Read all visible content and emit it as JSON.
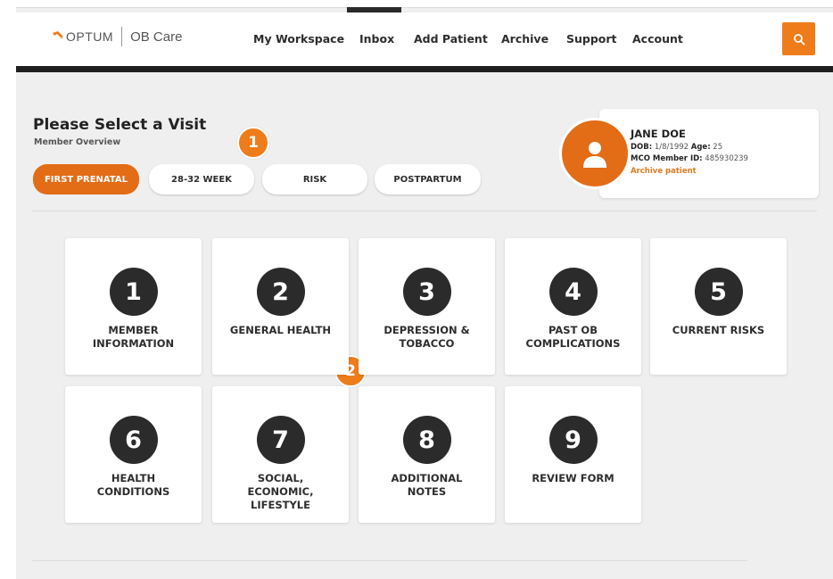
{
  "brand": {
    "name": "OPTUM",
    "product": "OB Care",
    "mark_color": "#ef7c1a"
  },
  "nav": {
    "items": [
      {
        "label": "My Workspace"
      },
      {
        "label": "Inbox"
      },
      {
        "label": "Add Patient"
      },
      {
        "label": "Archive"
      },
      {
        "label": "Support"
      },
      {
        "label": "Account"
      }
    ],
    "search_icon": "search-icon"
  },
  "page": {
    "title": "Please Select a Visit",
    "subtitle": "Member Overview"
  },
  "callouts": [
    "1",
    "2"
  ],
  "visit_tabs": [
    {
      "label": "FIRST PRENATAL",
      "active": true
    },
    {
      "label": "28-32 WEEK",
      "active": false
    },
    {
      "label": "RISK",
      "active": false
    },
    {
      "label": "POSTPARTUM",
      "active": false
    }
  ],
  "patient": {
    "avatar_icon": "user-icon",
    "name": "JANE DOE",
    "dob_label": "DOB:",
    "dob": "1/8/1992",
    "age_label": "Age:",
    "age": "25",
    "member_id_label": "MCO Member ID:",
    "member_id": "485930239",
    "archive_link": "Archive patient"
  },
  "sections": [
    {
      "number": "1",
      "label": "MEMBER\nINFORMATION"
    },
    {
      "number": "2",
      "label": "GENERAL HEALTH"
    },
    {
      "number": "3",
      "label": "DEPRESSION &\nTOBACCO"
    },
    {
      "number": "4",
      "label": "PAST OB\nCOMPLICATIONS"
    },
    {
      "number": "5",
      "label": "CURRENT RISKS"
    },
    {
      "number": "6",
      "label": "HEALTH\nCONDITIONS"
    },
    {
      "number": "7",
      "label": "SOCIAL,\nECONOMIC,\nLIFESTYLE"
    },
    {
      "number": "8",
      "label": "ADDITIONAL\nNOTES"
    },
    {
      "number": "9",
      "label": "REVIEW FORM"
    }
  ],
  "colors": {
    "accent": "#e36c17",
    "dark": "#2b2b2b",
    "background": "#efefef"
  }
}
